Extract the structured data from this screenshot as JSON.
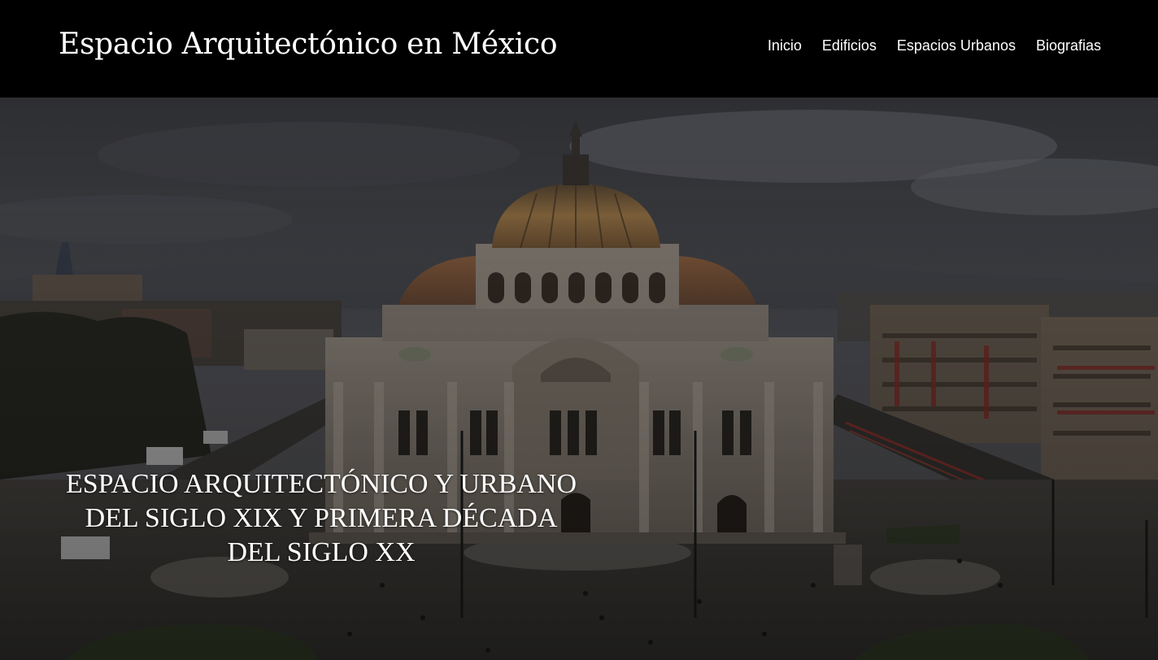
{
  "site": {
    "title": "Espacio Arquitectónico en México"
  },
  "nav": {
    "items": [
      {
        "label": "Inicio",
        "name": "nav-link-inicio"
      },
      {
        "label": "Edificios",
        "name": "nav-link-edificios"
      },
      {
        "label": "Espacios Urbanos",
        "name": "nav-link-espacios-urbanos"
      },
      {
        "label": "Biografias",
        "name": "nav-link-biografias"
      }
    ]
  },
  "hero": {
    "heading_lines": [
      "ESPACIO ARQUITECTÓNICO Y URBANO",
      "DEL SIGLO XIX Y PRIMERA DÉCADA",
      "DEL SIGLO XX"
    ]
  },
  "colors": {
    "header_bg": "#000000",
    "header_text": "#ffffff",
    "hero_overlay": "#2b2b2d"
  }
}
